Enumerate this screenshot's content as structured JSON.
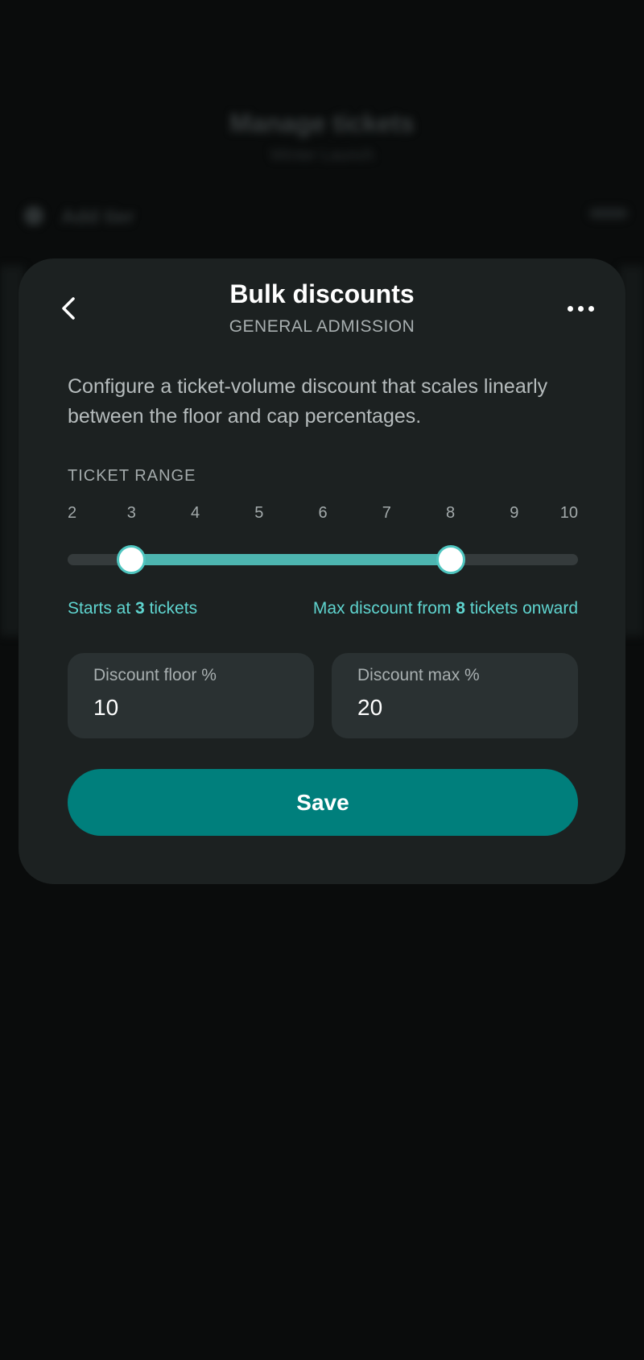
{
  "background": {
    "title": "Manage tickets",
    "subtitle": "Winter Launch",
    "row_label": "Add tier"
  },
  "sheet": {
    "back_icon": "chevron-left-icon",
    "more_icon": "more-horizontal-icon",
    "title": "Bulk discounts",
    "subtitle": "GENERAL ADMISSION",
    "description": "Configure a ticket-volume discount that scales linearly between the floor and cap percentages.",
    "range_label": "TICKET RANGE",
    "ticks": [
      "2",
      "3",
      "4",
      "5",
      "6",
      "7",
      "8",
      "9",
      "10"
    ],
    "slider": {
      "min": 2,
      "max": 10,
      "low": 3,
      "high": 8
    },
    "note_left": {
      "prefix": "Starts at ",
      "value": "3",
      "suffix": " tickets"
    },
    "note_right": {
      "prefix": "Max discount from ",
      "value": "8",
      "suffix": " tickets onward"
    },
    "floor_field": {
      "label": "Discount floor %",
      "value": "10"
    },
    "max_field": {
      "label": "Discount max %",
      "value": "20"
    },
    "save_label": "Save"
  },
  "colors": {
    "accent": "#4db5b0",
    "accent_text": "#5fd4cf",
    "button": "#007f7c",
    "sheet": "#1c2121"
  }
}
